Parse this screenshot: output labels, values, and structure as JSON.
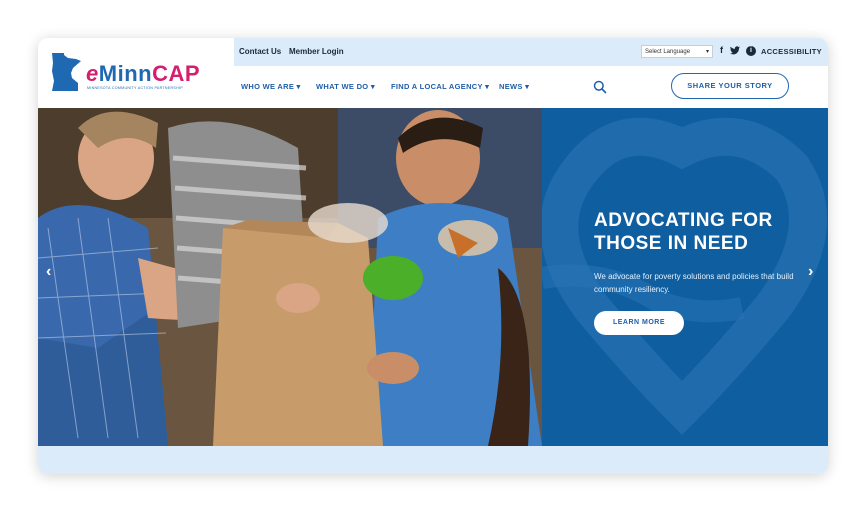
{
  "logo": {
    "brand_e": "e",
    "brand_minn": "Minn",
    "brand_cap": "CAP",
    "tagline": "MINNESOTA COMMUNITY ACTION PARTNERSHIP"
  },
  "topbar": {
    "contact_label": "Contact Us",
    "member_label": "Member Login",
    "language_select": "Select Language",
    "accessibility_label": "ACCESSIBILITY"
  },
  "nav": {
    "items": [
      {
        "label": "WHO WE ARE"
      },
      {
        "label": "WHAT WE DO"
      },
      {
        "label": "FIND A LOCAL AGENCY"
      },
      {
        "label": "NEWS"
      }
    ],
    "share_label": "SHARE YOUR STORY"
  },
  "hero": {
    "heading": "ADVOCATING FOR THOSE IN NEED",
    "subtext": "We advocate for poverty solutions and policies that build community resiliency.",
    "button_label": "LEARN MORE"
  },
  "colors": {
    "brand_blue": "#1f69b3",
    "brand_pink": "#d41e6e",
    "panel_blue": "#0f5ea0",
    "light_blue": "#dcebfa"
  }
}
